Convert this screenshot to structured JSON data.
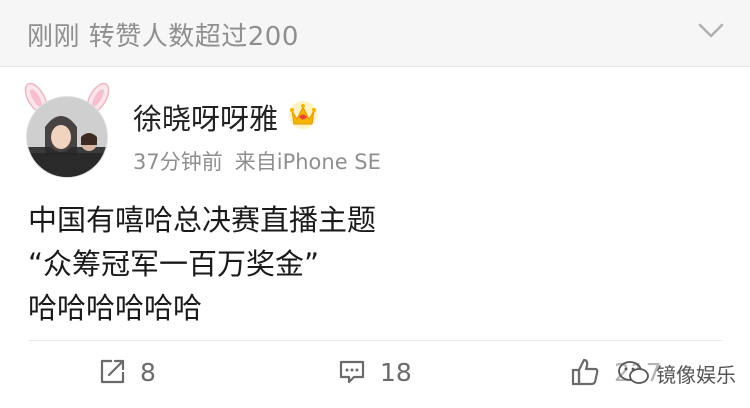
{
  "topbar": {
    "hint": "刚刚 转赞人数超过200",
    "collapse_icon": "chevron-down-icon"
  },
  "post": {
    "username": "徐晓呀呀雅",
    "badge_icon": "crown-icon",
    "time": "37分钟前",
    "source": "来自iPhone SE",
    "lines": [
      "中国有嘻哈总决赛直播主题",
      "“众筹冠军一百万奖金”",
      "哈哈哈哈哈哈"
    ]
  },
  "actions": {
    "share_count": "8",
    "comment_count": "18",
    "like_count": "217"
  },
  "watermark": {
    "text": "镜像娱乐"
  },
  "colors": {
    "topbar_bg": "#f6f6f6",
    "hint_text": "#8f8f8f",
    "crown_gold": "#f5b400",
    "crown_red": "#e8443a"
  }
}
